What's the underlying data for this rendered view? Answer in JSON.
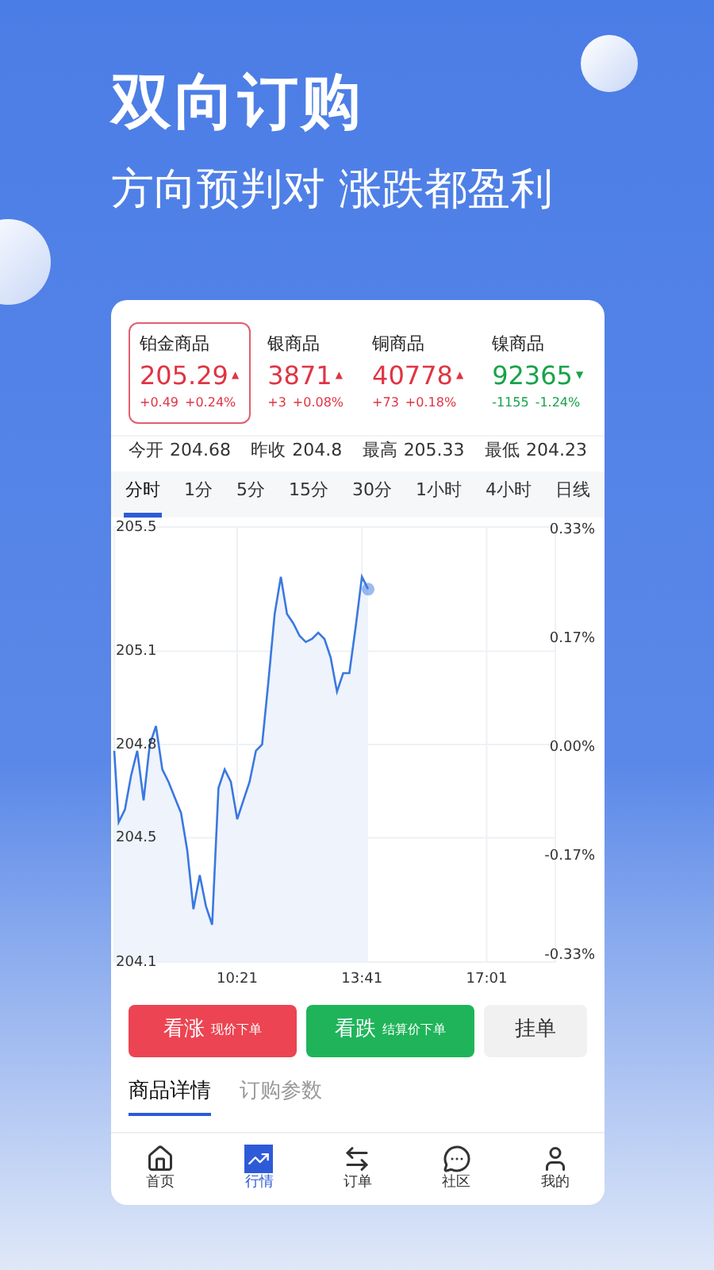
{
  "headline": "双向订购",
  "subheadline": "方向预判对 涨跌都盈利",
  "quotes": [
    {
      "name": "铂金商品",
      "price": "205.29",
      "arrow": "▲",
      "change": "+0.49",
      "percent": "+0.24%",
      "color": "#e03444",
      "selected": true
    },
    {
      "name": "银商品",
      "price": "3871",
      "arrow": "▲",
      "change": "+3",
      "percent": "+0.08%",
      "color": "#e03444",
      "selected": false
    },
    {
      "name": "铜商品",
      "price": "40778",
      "arrow": "▲",
      "change": "+73",
      "percent": "+0.18%",
      "color": "#e03444",
      "selected": false
    },
    {
      "name": "镍商品",
      "price": "92365",
      "arrow": "▼",
      "change": "-1155",
      "percent": "-1.24%",
      "color": "#17a34a",
      "selected": false
    }
  ],
  "stats": [
    {
      "label": "今开",
      "value": "204.68"
    },
    {
      "label": "昨收",
      "value": "204.8"
    },
    {
      "label": "最高",
      "value": "205.33"
    },
    {
      "label": "最低",
      "value": "204.23"
    }
  ],
  "periods": [
    {
      "label": "分时",
      "selected": true
    },
    {
      "label": "1分",
      "selected": false
    },
    {
      "label": "5分",
      "selected": false
    },
    {
      "label": "15分",
      "selected": false
    },
    {
      "label": "30分",
      "selected": false
    },
    {
      "label": "1小时",
      "selected": false
    },
    {
      "label": "4小时",
      "selected": false
    },
    {
      "label": "日线",
      "selected": false
    }
  ],
  "chart": {
    "right_axis_labels": [
      "0.33%",
      "0.17%",
      "0.00%",
      "-0.17%",
      "-0.33%"
    ],
    "chart_data": {
      "type": "line",
      "ylim": [
        204.1,
        205.5
      ],
      "grid": true,
      "categories": [
        null,
        null,
        null,
        null,
        null,
        null,
        null,
        null,
        null,
        null,
        null,
        null,
        null,
        null,
        null,
        null,
        null,
        null,
        null,
        null,
        "10:21",
        null,
        null,
        null,
        null,
        null,
        null,
        null,
        null,
        null,
        null,
        null,
        null,
        null,
        null,
        null,
        null,
        null,
        null,
        null,
        "13:41",
        null,
        null,
        null,
        null,
        null,
        null,
        null,
        null,
        null,
        null,
        null,
        null,
        null,
        null,
        null,
        null,
        null,
        null,
        null,
        "17:01",
        null,
        null,
        null,
        null,
        null,
        null,
        null,
        null,
        null,
        null
      ],
      "yticks": [
        205.5,
        205.1,
        204.8,
        204.5,
        204.1
      ],
      "series": [
        {
          "color": "#3a78e0",
          "values": [
            204.78,
            204.55,
            204.59,
            204.7,
            204.78,
            204.62,
            204.8,
            204.86,
            204.72,
            204.68,
            204.63,
            204.58,
            204.46,
            204.27,
            204.38,
            204.28,
            204.22,
            204.66,
            204.72,
            204.68,
            204.56,
            204.62,
            204.68,
            204.78,
            204.8,
            205.0,
            205.22,
            205.34,
            205.22,
            205.19,
            205.15,
            205.13,
            205.14,
            205.16,
            205.14,
            205.08,
            204.97,
            205.03,
            205.03,
            205.18,
            205.34,
            205.3,
            null,
            null,
            null,
            null,
            null,
            null,
            null,
            null,
            null,
            null,
            null,
            null,
            null,
            null,
            null,
            null,
            null,
            null,
            null,
            null,
            null,
            null,
            null,
            null,
            null,
            null,
            null,
            null,
            null
          ]
        }
      ]
    }
  },
  "actions": [
    {
      "kind": "buy",
      "label": "看涨",
      "note": "现价下单"
    },
    {
      "kind": "sell",
      "label": "看跌",
      "note": "结算价下单"
    },
    {
      "kind": "pending",
      "label": "挂单"
    }
  ],
  "detail_tabs": [
    {
      "label": "商品详情",
      "selected": true
    },
    {
      "label": "订购参数",
      "selected": false
    }
  ],
  "nav": [
    {
      "label": "首页",
      "selected": false
    },
    {
      "label": "行情",
      "selected": true
    },
    {
      "label": "订单",
      "selected": false
    },
    {
      "label": "社区",
      "selected": false
    },
    {
      "label": "我的",
      "selected": false
    }
  ]
}
